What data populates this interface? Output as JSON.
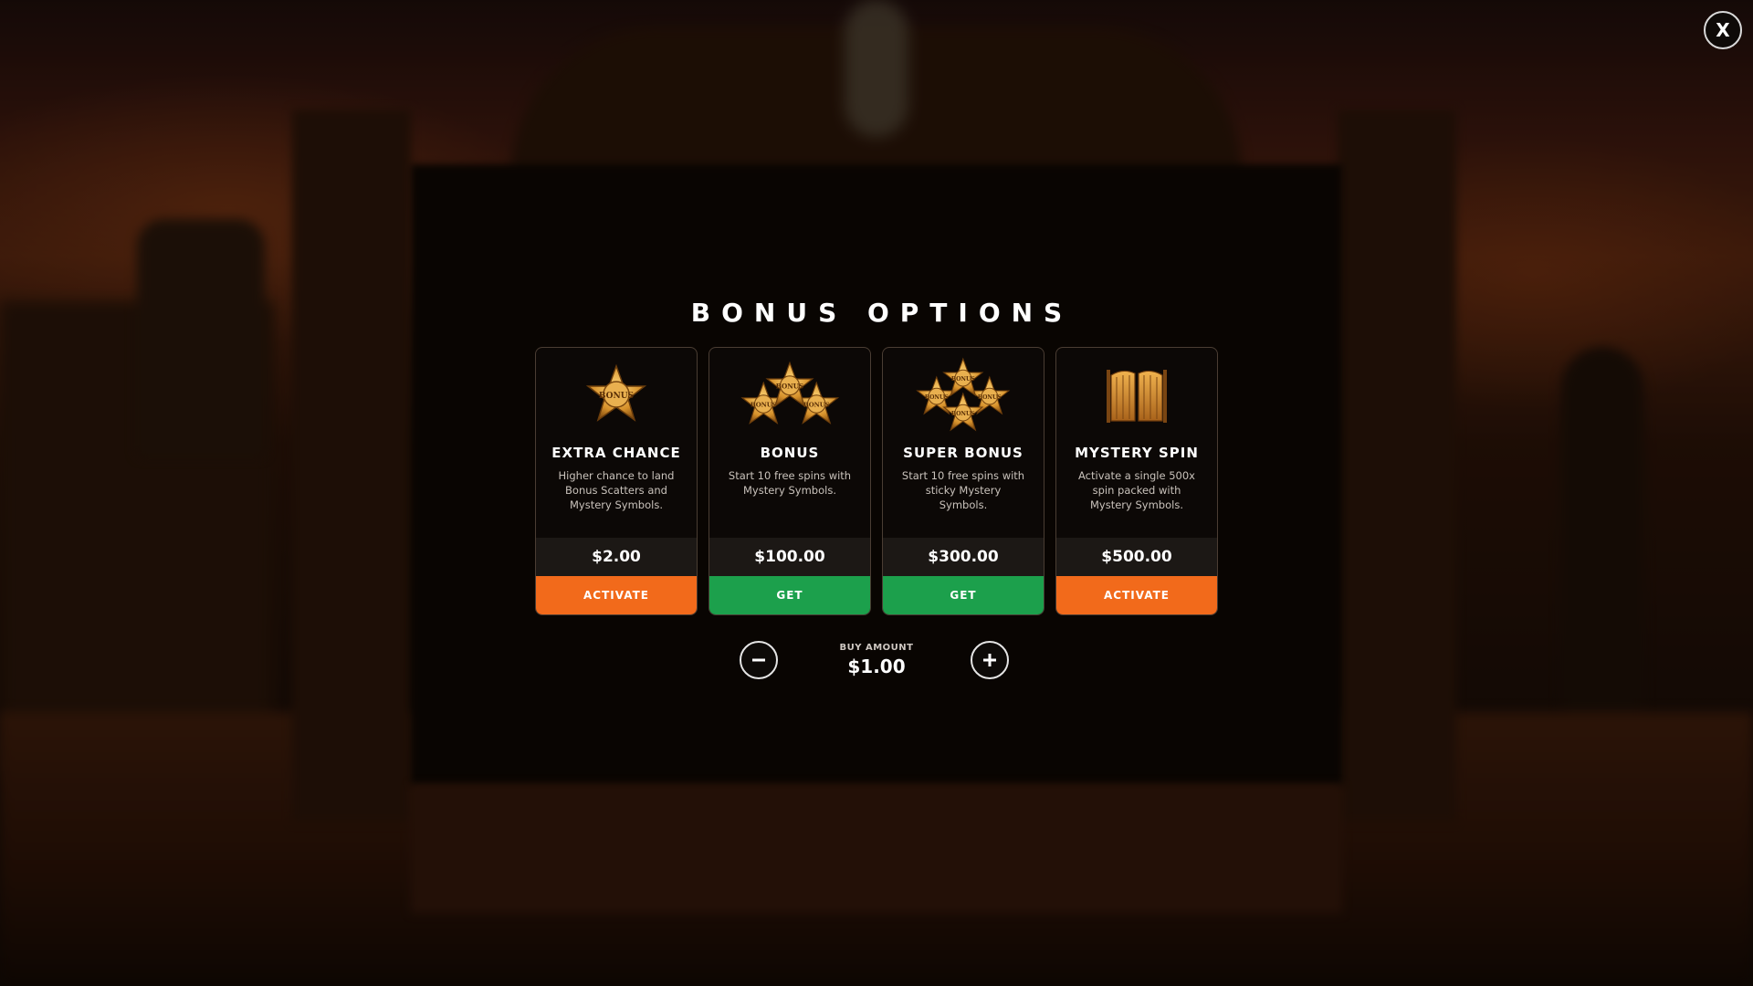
{
  "title": "BONUS OPTIONS",
  "close_label": "X",
  "cards": [
    {
      "name": "EXTRA CHANCE",
      "description": "Higher chance to land Bonus Scatters and Mystery Symbols.",
      "price": "$2.00",
      "button": "ACTIVATE",
      "button_color": "#f26a1b",
      "icon": "single-bonus-star-badge-icon",
      "badge_text": "BONUS"
    },
    {
      "name": "BONUS",
      "description": "Start 10 free spins with Mystery Symbols.",
      "price": "$100.00",
      "button": "GET",
      "button_color": "#1ca04c",
      "icon": "triple-bonus-star-badge-icon",
      "badge_text": "BONUS"
    },
    {
      "name": "SUPER BONUS",
      "description": "Start 10 free spins with sticky Mystery Symbols.",
      "price": "$300.00",
      "button": "GET",
      "button_color": "#1ca04c",
      "icon": "quad-bonus-star-badge-icon",
      "badge_text": "BONUS"
    },
    {
      "name": "MYSTERY SPIN",
      "description": "Activate a single 500x spin packed with Mystery Symbols.",
      "price": "$500.00",
      "button": "ACTIVATE",
      "button_color": "#f26a1b",
      "icon": "saloon-doors-icon"
    }
  ],
  "buy_amount": {
    "label": "BUY AMOUNT",
    "value": "$1.00",
    "minus_icon": "minus-icon",
    "plus_icon": "plus-icon"
  },
  "colors": {
    "accent_orange": "#f26a1b",
    "accent_green": "#1ca04c",
    "gold": "#e0a83a"
  }
}
